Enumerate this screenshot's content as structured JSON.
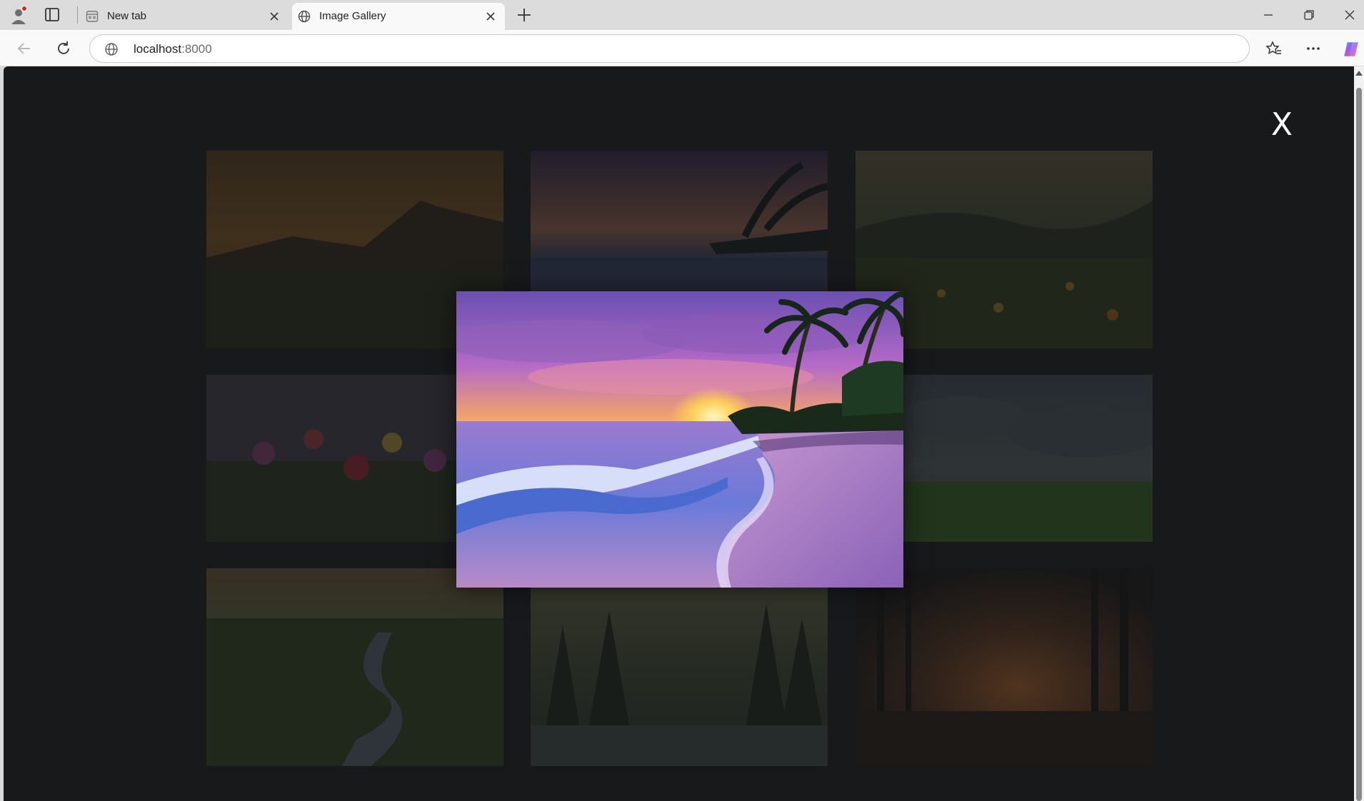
{
  "browser": {
    "tabs": [
      {
        "title": "New tab",
        "active": false
      },
      {
        "title": "Image Gallery",
        "active": true
      }
    ],
    "address": {
      "host": "localhost",
      "port": ":8000"
    }
  },
  "page": {
    "close_label": "X",
    "gallery": [
      {
        "name": "mountain-meadow-sunset"
      },
      {
        "name": "tropical-beach-sunset"
      },
      {
        "name": "hills-flower-field"
      },
      {
        "name": "wildflowers"
      },
      {
        "name": "green-field-cloudy-sky"
      },
      {
        "name": "river-through-marsh"
      },
      {
        "name": "pine-forest-lake-sunset"
      },
      {
        "name": "forest-lake-deer-sunset"
      }
    ],
    "lightbox": {
      "image": "tropical-beach-sunset"
    }
  }
}
